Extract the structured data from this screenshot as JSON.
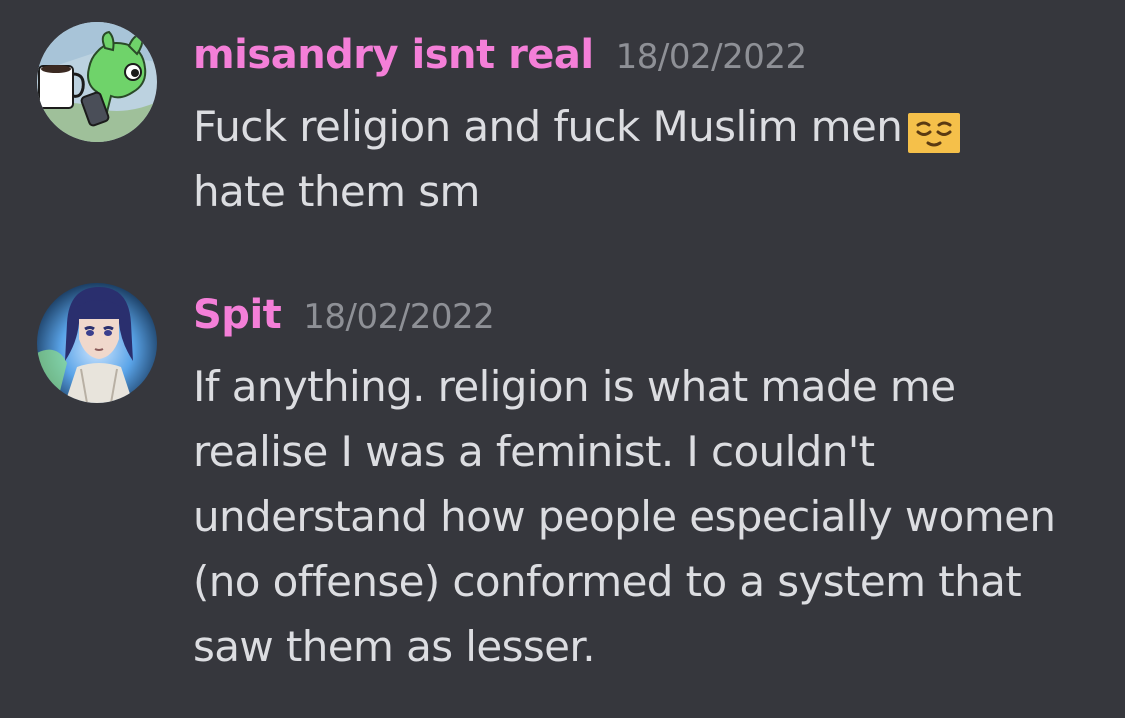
{
  "messages": [
    {
      "username": "misandry isnt real",
      "timestamp": "18/02/2022",
      "username_color": "#f47fd8",
      "avatar_icon": "green-creature-with-mug-avatar",
      "lines": [
        "Fuck religion and fuck Muslim men",
        "hate them sm"
      ],
      "emoji": "relieved-face-emoji"
    },
    {
      "username": "Spit",
      "timestamp": "18/02/2022",
      "username_color": "#f47fd8",
      "avatar_icon": "anime-girl-avatar",
      "lines": [
        "If anything. religion is what made me",
        "realise I was a feminist. I couldn't",
        "understand how people especially women",
        "(no offense) conformed to a system that",
        "saw them as lesser."
      ]
    }
  ],
  "colors": {
    "background": "#36373d",
    "text": "#dcdde1",
    "timestamp": "#8e9096"
  }
}
